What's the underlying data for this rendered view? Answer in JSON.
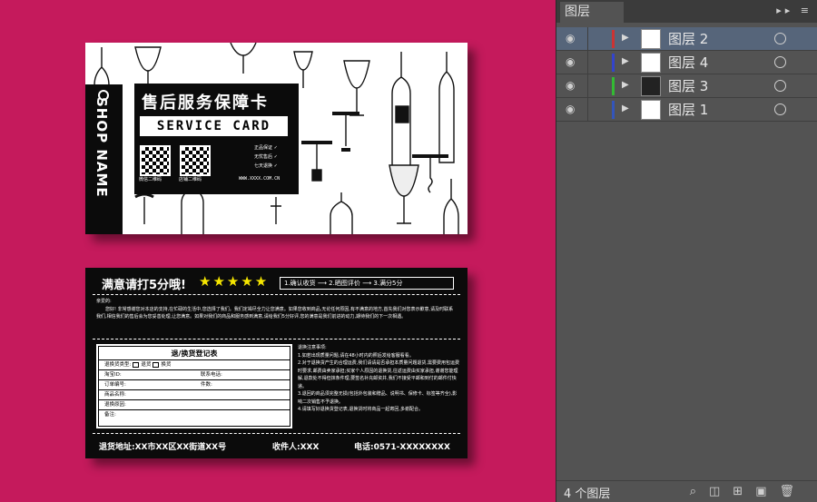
{
  "panel": {
    "tab_label": "图层",
    "header_icons": "▸▸ ≡",
    "layers": [
      {
        "name": "图层 2",
        "color": "#cc3333",
        "selected": true
      },
      {
        "name": "图层 4",
        "color": "#3344cc",
        "selected": false
      },
      {
        "name": "图层 3",
        "color": "#33bb33",
        "selected": false
      },
      {
        "name": "图层 1",
        "color": "#3355bb",
        "selected": false
      }
    ],
    "layer_count": "4 个图层",
    "footer_icons": [
      "search-icon",
      "clip-mask-icon",
      "new-sublayer-icon",
      "new-layer-icon",
      "trash-icon"
    ]
  },
  "front": {
    "shop_name": "SHOP NAME",
    "title_cn": "售后服务保障卡",
    "title_en": "SERVICE CARD",
    "qr_left_label": "微信二维码",
    "qr_right_label": "店铺二维码",
    "features": [
      "正品保证 ✓",
      "无忧售后 ✓",
      "七天退换 ✓"
    ],
    "url": "WWW.XXXX.COM.CN"
  },
  "back": {
    "title": "满意请打5分哦!",
    "stars": "★★★★★",
    "steps": "1.确认收货 ⟶ 2.晒图评价 ⟶ 3.满分5分",
    "greeting": "亲爱的:",
    "paragraph": "　　您好! 非常感谢您对本店的支持,在忙碌的生活中,您选择了我们。我们定竭尽全力让您满意。如果您收到商品,无论任何原因,有不满意的地方,首先我们对您表示歉意,请及时联系我们,相信我们的售后会为您妥善处理,让您满意。如果对我们的商品和服务感到满意,请给我们5分好评,您的满意是我们前进的动力,期待我们的下一次相遇。",
    "form": {
      "title": "退/换货登记表",
      "type_label": "退换货类型:",
      "return_label": "退货",
      "exchange_label": "换货",
      "taobao_id": "淘宝ID:",
      "phone": "联系电话:",
      "order_no": "订单编号:",
      "qty": "件数:",
      "product": "商品名称:",
      "reason": "退换原因:",
      "remark": "备注:"
    },
    "notes_title": "退换注意事项:",
    "notes": [
      "1.如若出现质量问题,请在48小时内的照后发给客服看看。",
      "2.对于退换货产生的合理运费,我们请请是否承担本质量问题退货,需要费用包运费时要求,邮费由卖家承担;买家个人原因的退换货,往返运费由买家承担,谢谢您能理解,退款处不得但抹条件理,要签名补充邮资并,我们不接受平邮和到付的邮件付快递。",
      "3.退回的商品须完整无损(包括外包装和赠品、说明书、保修卡、标签等齐全),影响二次销售不予退换。",
      "4.请填写好退换货登记表,退换货时将商品一起寄回,多谢配合。"
    ],
    "address": "退货地址:XX市XX区XX街道XX号",
    "recipient": "收件人:XXX",
    "phone": "电话:0571-XXXXXXXX"
  }
}
